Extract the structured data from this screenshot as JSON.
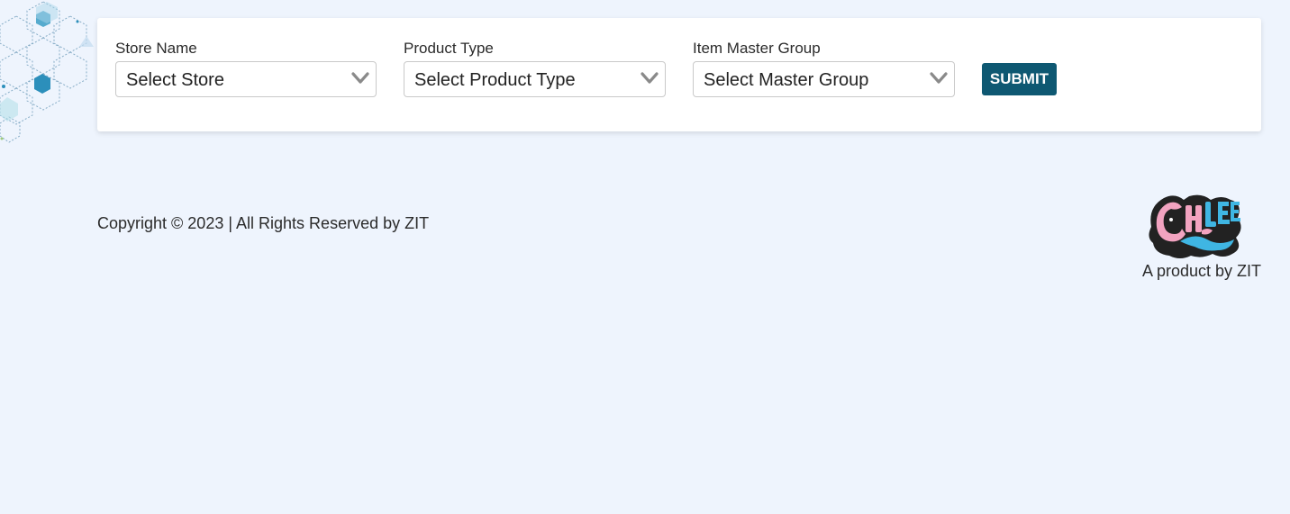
{
  "filters": {
    "store": {
      "label": "Store Name",
      "value": "Select Store"
    },
    "product_type": {
      "label": "Product Type",
      "value": "Select Product Type"
    },
    "master_group": {
      "label": "Item Master Group",
      "value": "Select Master Group"
    },
    "submit_label": "SUBMIT"
  },
  "footer": {
    "copyright": "Copyright © 2023 | All Rights Reserved by ZIT",
    "product_by": "A product by ZIT",
    "logo_text": "CHIKLEE WATER PARK"
  },
  "colors": {
    "page_background": "#eef4fd",
    "card_background": "#ffffff",
    "submit_button": "#0e5872",
    "logo_pink": "#f2a3c0",
    "logo_blue": "#3fb6e3"
  },
  "icons": {
    "dropdown": "chevron-down-icon",
    "decoration": "hexagon-pattern"
  }
}
